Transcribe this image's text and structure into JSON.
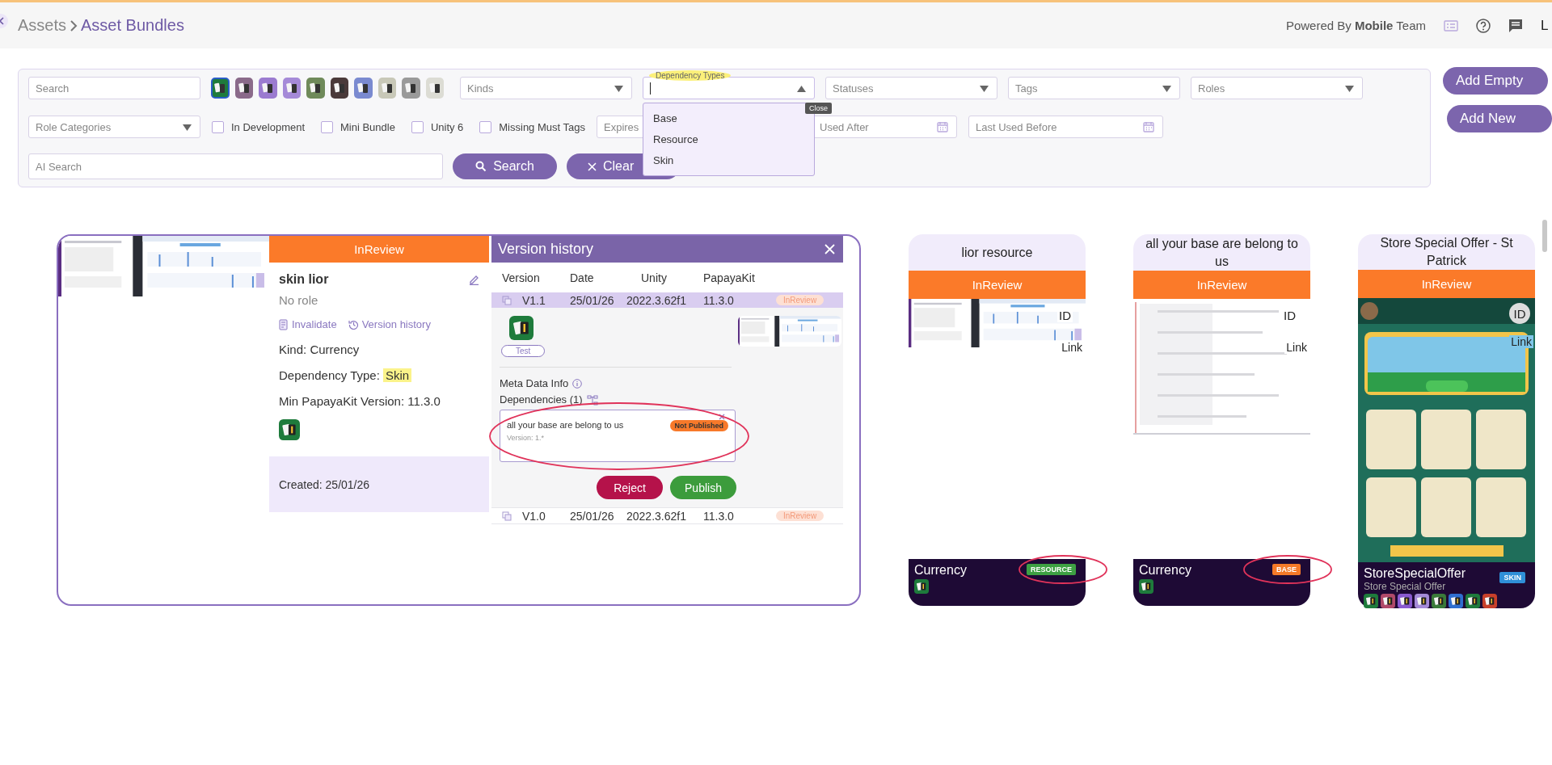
{
  "header": {
    "breadcrumb": [
      {
        "label": "Assets",
        "selected": false
      },
      {
        "label": "Asset Bundles",
        "selected": true
      }
    ],
    "powered_by": "Powered By **Mobile** Team",
    "user": "L"
  },
  "filters": {
    "search": {
      "placeholder": "Search"
    },
    "apps": [
      {
        "selected": true,
        "color": "#1e7b3c"
      },
      {
        "selected": false,
        "color": "#8a6a8a"
      },
      {
        "selected": false,
        "color": "#9b7bd0"
      },
      {
        "selected": false,
        "color": "#a58ad8"
      },
      {
        "selected": false,
        "color": "#6f8a5a"
      },
      {
        "selected": false,
        "color": "#4a3a3a"
      },
      {
        "selected": false,
        "color": "#7a8ad0"
      },
      {
        "selected": false,
        "color": "#c8c8b8"
      },
      {
        "selected": false,
        "color": "#9a9a9a"
      },
      {
        "selected": false,
        "color": "#dcdcd4"
      }
    ],
    "selects": [
      {
        "placeholder": "Kinds",
        "open": false
      },
      {
        "label": "Dependency Types",
        "open": true,
        "highlighted": true,
        "options": [
          "Base",
          "Resource",
          "Skin"
        ],
        "tooltip": "Close"
      },
      {
        "placeholder": "Statuses",
        "open": false
      },
      {
        "placeholder": "Tags",
        "open": false
      },
      {
        "placeholder": "Roles",
        "open": false
      }
    ],
    "role_categories": {
      "placeholder": "Role Categories",
      "open": false
    },
    "checkboxes": [
      {
        "label": "In Development",
        "checked": false
      },
      {
        "label": "Mini Bundle",
        "checked": false
      },
      {
        "label": "Unity 6",
        "checked": false
      },
      {
        "label": "Missing Must Tags",
        "checked": false
      }
    ],
    "dates": [
      {
        "placeholder": "Expires",
        "calendar_icon": false
      },
      {
        "placeholder": "Used After",
        "calendar_icon": true
      },
      {
        "placeholder": "Last Used Before",
        "calendar_icon": true
      }
    ],
    "ai_search": {
      "placeholder": "AI Search"
    },
    "buttons": [
      {
        "label": "Search",
        "kind": "search"
      },
      {
        "label": "Clear",
        "kind": "clear"
      }
    ]
  },
  "actions": [
    {
      "label": "Add Empty"
    },
    {
      "label": "Add New"
    }
  ],
  "expanded_card": {
    "status": "InReview",
    "name": "skin lior",
    "role": "No role",
    "links": [
      {
        "label": "Invalidate",
        "kind": "invalidate"
      },
      {
        "label": "Version history",
        "kind": "history"
      }
    ],
    "fields": [
      {
        "label": "Kind:",
        "value": "Currency",
        "highlighted": false
      },
      {
        "label": "Dependency Type:",
        "value": "Skin",
        "highlighted": true
      },
      {
        "label": "Min PapayaKit Version:",
        "value": "11.3.0",
        "highlighted": false
      }
    ],
    "created": "Created: 25/01/26",
    "version_history": {
      "title": "Version history",
      "columns": [
        "Version",
        "Date",
        "Unity",
        "PapayaKit"
      ],
      "rows": [
        {
          "version": "V1.1",
          "date": "25/01/26",
          "unity": "2022.3.62f1",
          "papayakit": "11.3.0",
          "status": "InReview",
          "selected": true,
          "expanded": true
        },
        {
          "version": "V1.0",
          "date": "25/01/26",
          "unity": "2022.3.62f1",
          "papayakit": "11.3.0",
          "status": "InReview",
          "selected": false,
          "expanded": false
        }
      ],
      "detail": {
        "tag": "Test",
        "meta_label": "Meta Data Info",
        "dependencies_label": "Dependencies (1)",
        "dependencies": [
          {
            "name": "all your base are belong to us",
            "version": "Version: 1.*",
            "status": "Not Published",
            "circled": true
          }
        ],
        "buttons": [
          {
            "label": "Reject",
            "kind": "reject"
          },
          {
            "label": "Publish",
            "kind": "publish"
          }
        ]
      }
    }
  },
  "cards": [
    {
      "title": "lior resource",
      "status": "InReview",
      "kind": "screenshot",
      "id_label": "ID",
      "link_label": "Link",
      "name": "Currency",
      "badge": "RESOURCE",
      "color": "#3ea043",
      "circled": true,
      "app_icons": [
        {
          "color": "#1e7b3c"
        }
      ]
    },
    {
      "title": "all your base are belong to us",
      "status": "InReview",
      "kind": "log",
      "id_label": "ID",
      "link_label": "Link",
      "name": "Currency",
      "badge": "BASE",
      "color": "#f47a28",
      "circled": true,
      "app_icons": [
        {
          "color": "#1e7b3c"
        }
      ]
    },
    {
      "title": "Store Special Offer - St Patrick",
      "status": "InReview",
      "kind": "game",
      "id_label": "ID",
      "link_label": "Link",
      "name": "StoreSpecialOffer",
      "subtitle": "Store Special Offer",
      "badge": "SKIN",
      "color": "#2f8fd8",
      "circled": false,
      "app_icons": [
        {
          "color": "#1e7b3c"
        },
        {
          "color": "#b04a6a"
        },
        {
          "color": "#8a5ad0"
        },
        {
          "color": "#a58ad8"
        },
        {
          "color": "#3a7a3a"
        },
        {
          "color": "#2f6fd0"
        },
        {
          "color": "#1e7b3c"
        },
        {
          "color": "#c8402a"
        }
      ]
    }
  ]
}
